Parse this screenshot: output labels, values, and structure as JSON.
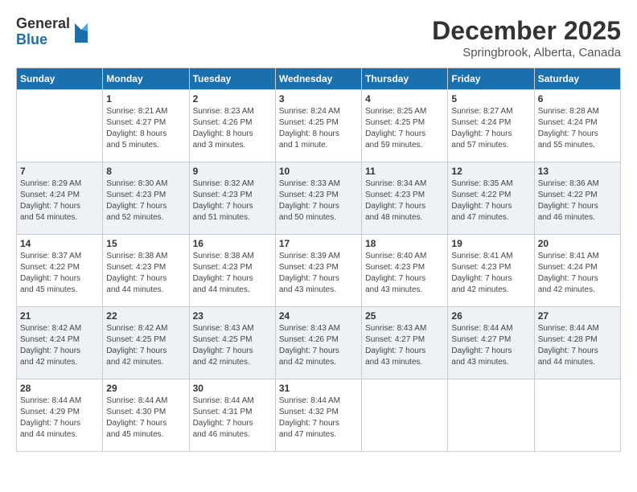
{
  "logo": {
    "general": "General",
    "blue": "Blue"
  },
  "title": "December 2025",
  "location": "Springbrook, Alberta, Canada",
  "weekdays": [
    "Sunday",
    "Monday",
    "Tuesday",
    "Wednesday",
    "Thursday",
    "Friday",
    "Saturday"
  ],
  "weeks": [
    [
      {
        "day": "",
        "info": ""
      },
      {
        "day": "1",
        "info": "Sunrise: 8:21 AM\nSunset: 4:27 PM\nDaylight: 8 hours\nand 5 minutes."
      },
      {
        "day": "2",
        "info": "Sunrise: 8:23 AM\nSunset: 4:26 PM\nDaylight: 8 hours\nand 3 minutes."
      },
      {
        "day": "3",
        "info": "Sunrise: 8:24 AM\nSunset: 4:25 PM\nDaylight: 8 hours\nand 1 minute."
      },
      {
        "day": "4",
        "info": "Sunrise: 8:25 AM\nSunset: 4:25 PM\nDaylight: 7 hours\nand 59 minutes."
      },
      {
        "day": "5",
        "info": "Sunrise: 8:27 AM\nSunset: 4:24 PM\nDaylight: 7 hours\nand 57 minutes."
      },
      {
        "day": "6",
        "info": "Sunrise: 8:28 AM\nSunset: 4:24 PM\nDaylight: 7 hours\nand 55 minutes."
      }
    ],
    [
      {
        "day": "7",
        "info": "Sunrise: 8:29 AM\nSunset: 4:24 PM\nDaylight: 7 hours\nand 54 minutes."
      },
      {
        "day": "8",
        "info": "Sunrise: 8:30 AM\nSunset: 4:23 PM\nDaylight: 7 hours\nand 52 minutes."
      },
      {
        "day": "9",
        "info": "Sunrise: 8:32 AM\nSunset: 4:23 PM\nDaylight: 7 hours\nand 51 minutes."
      },
      {
        "day": "10",
        "info": "Sunrise: 8:33 AM\nSunset: 4:23 PM\nDaylight: 7 hours\nand 50 minutes."
      },
      {
        "day": "11",
        "info": "Sunrise: 8:34 AM\nSunset: 4:23 PM\nDaylight: 7 hours\nand 48 minutes."
      },
      {
        "day": "12",
        "info": "Sunrise: 8:35 AM\nSunset: 4:22 PM\nDaylight: 7 hours\nand 47 minutes."
      },
      {
        "day": "13",
        "info": "Sunrise: 8:36 AM\nSunset: 4:22 PM\nDaylight: 7 hours\nand 46 minutes."
      }
    ],
    [
      {
        "day": "14",
        "info": "Sunrise: 8:37 AM\nSunset: 4:22 PM\nDaylight: 7 hours\nand 45 minutes."
      },
      {
        "day": "15",
        "info": "Sunrise: 8:38 AM\nSunset: 4:23 PM\nDaylight: 7 hours\nand 44 minutes."
      },
      {
        "day": "16",
        "info": "Sunrise: 8:38 AM\nSunset: 4:23 PM\nDaylight: 7 hours\nand 44 minutes."
      },
      {
        "day": "17",
        "info": "Sunrise: 8:39 AM\nSunset: 4:23 PM\nDaylight: 7 hours\nand 43 minutes."
      },
      {
        "day": "18",
        "info": "Sunrise: 8:40 AM\nSunset: 4:23 PM\nDaylight: 7 hours\nand 43 minutes."
      },
      {
        "day": "19",
        "info": "Sunrise: 8:41 AM\nSunset: 4:23 PM\nDaylight: 7 hours\nand 42 minutes."
      },
      {
        "day": "20",
        "info": "Sunrise: 8:41 AM\nSunset: 4:24 PM\nDaylight: 7 hours\nand 42 minutes."
      }
    ],
    [
      {
        "day": "21",
        "info": "Sunrise: 8:42 AM\nSunset: 4:24 PM\nDaylight: 7 hours\nand 42 minutes."
      },
      {
        "day": "22",
        "info": "Sunrise: 8:42 AM\nSunset: 4:25 PM\nDaylight: 7 hours\nand 42 minutes."
      },
      {
        "day": "23",
        "info": "Sunrise: 8:43 AM\nSunset: 4:25 PM\nDaylight: 7 hours\nand 42 minutes."
      },
      {
        "day": "24",
        "info": "Sunrise: 8:43 AM\nSunset: 4:26 PM\nDaylight: 7 hours\nand 42 minutes."
      },
      {
        "day": "25",
        "info": "Sunrise: 8:43 AM\nSunset: 4:27 PM\nDaylight: 7 hours\nand 43 minutes."
      },
      {
        "day": "26",
        "info": "Sunrise: 8:44 AM\nSunset: 4:27 PM\nDaylight: 7 hours\nand 43 minutes."
      },
      {
        "day": "27",
        "info": "Sunrise: 8:44 AM\nSunset: 4:28 PM\nDaylight: 7 hours\nand 44 minutes."
      }
    ],
    [
      {
        "day": "28",
        "info": "Sunrise: 8:44 AM\nSunset: 4:29 PM\nDaylight: 7 hours\nand 44 minutes."
      },
      {
        "day": "29",
        "info": "Sunrise: 8:44 AM\nSunset: 4:30 PM\nDaylight: 7 hours\nand 45 minutes."
      },
      {
        "day": "30",
        "info": "Sunrise: 8:44 AM\nSunset: 4:31 PM\nDaylight: 7 hours\nand 46 minutes."
      },
      {
        "day": "31",
        "info": "Sunrise: 8:44 AM\nSunset: 4:32 PM\nDaylight: 7 hours\nand 47 minutes."
      },
      {
        "day": "",
        "info": ""
      },
      {
        "day": "",
        "info": ""
      },
      {
        "day": "",
        "info": ""
      }
    ]
  ]
}
